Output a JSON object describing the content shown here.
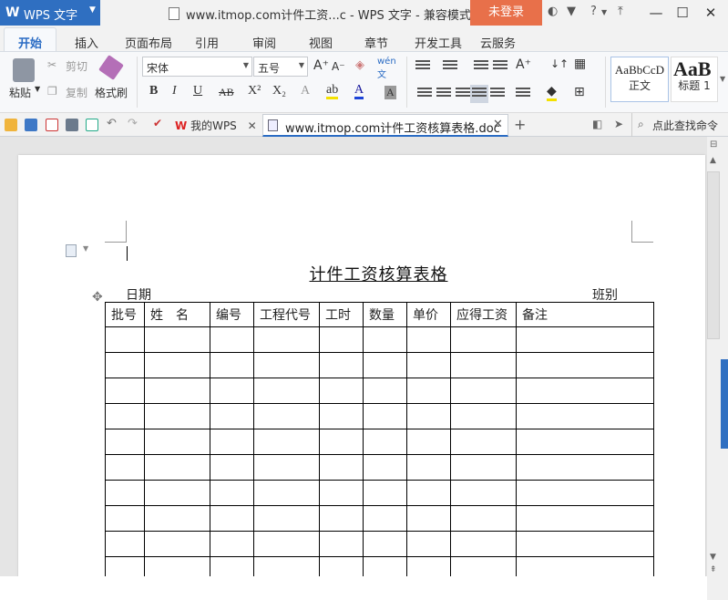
{
  "titlebar": {
    "app_logo": "W",
    "app_name": "WPS 文字",
    "window_title": "www.itmop.com计件工资...c - WPS 文字 - 兼容模式",
    "login_label": "未登录",
    "help_label": "?"
  },
  "menu_tabs": [
    "开始",
    "插入",
    "页面布局",
    "引用",
    "审阅",
    "视图",
    "章节",
    "开发工具",
    "云服务"
  ],
  "ribbon": {
    "paste": "粘贴",
    "cut": "剪切",
    "copy": "复制",
    "format_painter": "格式刷",
    "font_name": "宋体",
    "font_size": "五号",
    "bold": "B",
    "italic": "I",
    "underline": "U",
    "strikethrough": "AB",
    "superscript": "X²",
    "subscript": "X₂",
    "style_normal_sample": "AaBbCcD",
    "style_normal": "正文",
    "style_heading_sample": "AaB",
    "style_heading": "标题 1"
  },
  "quickbar": {
    "my_wps_tab": "我的WPS",
    "active_doc_tab": "www.itmop.com计件工资核算表格.doc",
    "add_tab": "+",
    "search_label": "点此查找命令"
  },
  "document": {
    "heading": "计件工资核算表格",
    "date_label": "日期",
    "shift_label": "班别",
    "table_headers": [
      "批号",
      "姓　名",
      "编号",
      "工程代号",
      "工时",
      "数量",
      "单价",
      "应得工资",
      "备注"
    ]
  },
  "colors": {
    "accent": "#2f6fc1",
    "login_bg": "#e8704a",
    "active_tab_text": "#2b6cc4"
  }
}
